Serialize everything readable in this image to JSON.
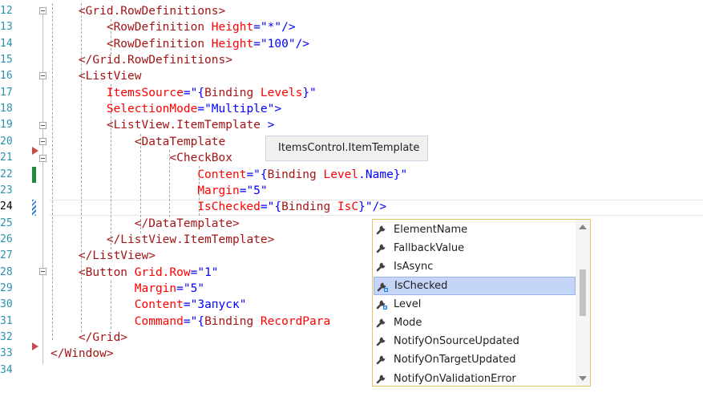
{
  "editor": {
    "current_line": "24",
    "lines": [
      {
        "n": "12",
        "c": [
          [
            "i",
            "    "
          ],
          [
            "t",
            "<Grid.RowDefinitions>"
          ]
        ]
      },
      {
        "n": "13",
        "c": [
          [
            "i",
            "        "
          ],
          [
            "t",
            "<RowDefinition "
          ],
          [
            "a",
            "Height"
          ],
          [
            "p",
            "=\"*\"/>"
          ]
        ]
      },
      {
        "n": "14",
        "c": [
          [
            "i",
            "        "
          ],
          [
            "t",
            "<RowDefinition "
          ],
          [
            "a",
            "Height"
          ],
          [
            "p",
            "=\"100\"/>"
          ]
        ]
      },
      {
        "n": "15",
        "c": [
          [
            "i",
            "    "
          ],
          [
            "t",
            "</Grid.RowDefinitions>"
          ]
        ]
      },
      {
        "n": "16",
        "c": [
          [
            "i",
            "    "
          ],
          [
            "t",
            "<ListView"
          ]
        ]
      },
      {
        "n": "17",
        "c": [
          [
            "i",
            "        "
          ],
          [
            "a",
            "ItemsSource"
          ],
          [
            "p",
            "=\"{"
          ],
          [
            "t",
            "Binding "
          ],
          [
            "a",
            "Levels"
          ],
          [
            "p",
            "}\""
          ]
        ]
      },
      {
        "n": "18",
        "c": [
          [
            "i",
            "        "
          ],
          [
            "a",
            "SelectionMode"
          ],
          [
            "p",
            "=\"Multiple\">"
          ]
        ]
      },
      {
        "n": "19",
        "c": [
          [
            "i",
            "        "
          ],
          [
            "t",
            "<ListView.ItemTemplate "
          ],
          [
            "p",
            ">"
          ]
        ]
      },
      {
        "n": "20",
        "c": [
          [
            "i",
            "            "
          ],
          [
            "t",
            "<DataTemplate"
          ]
        ]
      },
      {
        "n": "21",
        "c": [
          [
            "i",
            "                 "
          ],
          [
            "t",
            "<CheckBox"
          ]
        ]
      },
      {
        "n": "22",
        "c": [
          [
            "i",
            "                     "
          ],
          [
            "a",
            "Content"
          ],
          [
            "p",
            "=\"{"
          ],
          [
            "t",
            "Binding "
          ],
          [
            "a",
            "Level"
          ],
          [
            "p",
            "."
          ],
          [
            "b",
            "Name"
          ],
          [
            "p",
            "}\""
          ]
        ]
      },
      {
        "n": "23",
        "c": [
          [
            "i",
            "                     "
          ],
          [
            "a",
            "Margin"
          ],
          [
            "p",
            "=\"5\""
          ]
        ]
      },
      {
        "n": "24",
        "c": [
          [
            "i",
            "                     "
          ],
          [
            "a",
            "IsChecked"
          ],
          [
            "p",
            "=\"{"
          ],
          [
            "t",
            "Binding "
          ],
          [
            "a",
            "IsC"
          ],
          [
            "p",
            "}\"/>"
          ]
        ]
      },
      {
        "n": "25",
        "c": [
          [
            "i",
            "            "
          ],
          [
            "t",
            "</DataTemplate>"
          ]
        ]
      },
      {
        "n": "26",
        "c": [
          [
            "i",
            "        "
          ],
          [
            "t",
            "</ListView.ItemTemplate>"
          ]
        ]
      },
      {
        "n": "27",
        "c": [
          [
            "i",
            "    "
          ],
          [
            "t",
            "</ListView>"
          ]
        ]
      },
      {
        "n": "28",
        "c": [
          [
            "i",
            "    "
          ],
          [
            "t",
            "<Button "
          ],
          [
            "a",
            "Grid.Row"
          ],
          [
            "p",
            "=\"1\""
          ]
        ]
      },
      {
        "n": "29",
        "c": [
          [
            "i",
            "            "
          ],
          [
            "a",
            "Margin"
          ],
          [
            "p",
            "=\"5\""
          ]
        ]
      },
      {
        "n": "30",
        "c": [
          [
            "i",
            "            "
          ],
          [
            "a",
            "Content"
          ],
          [
            "p",
            "=\"Запуск\""
          ]
        ]
      },
      {
        "n": "31",
        "c": [
          [
            "i",
            "            "
          ],
          [
            "a",
            "Command"
          ],
          [
            "p",
            "=\"{"
          ],
          [
            "t",
            "Binding "
          ],
          [
            "a",
            "RecordPara"
          ]
        ]
      },
      {
        "n": "32",
        "c": [
          [
            "i",
            "    "
          ],
          [
            "t",
            "</Grid>"
          ]
        ]
      },
      {
        "n": "33",
        "c": [
          [
            "t",
            "</Window>"
          ]
        ]
      },
      {
        "n": "34",
        "c": []
      }
    ]
  },
  "tooltip": {
    "text": "ItemsControl.ItemTemplate"
  },
  "completion": {
    "items": [
      {
        "label": "ElementName",
        "icon": "wrench-icon",
        "selected": false
      },
      {
        "label": "FallbackValue",
        "icon": "wrench-icon",
        "selected": false
      },
      {
        "label": "IsAsync",
        "icon": "wrench-icon",
        "selected": false
      },
      {
        "label": "IsChecked",
        "icon": "wrench-blue-icon",
        "selected": true
      },
      {
        "label": "Level",
        "icon": "wrench-blue-icon",
        "selected": false
      },
      {
        "label": "Mode",
        "icon": "wrench-icon",
        "selected": false
      },
      {
        "label": "NotifyOnSourceUpdated",
        "icon": "wrench-icon",
        "selected": false
      },
      {
        "label": "NotifyOnTargetUpdated",
        "icon": "wrench-icon",
        "selected": false
      },
      {
        "label": "NotifyOnValidationError",
        "icon": "wrench-icon",
        "selected": false
      }
    ]
  },
  "colors": {
    "tag": "#a31515",
    "punct": "#0000ff",
    "attr": "#ff0000",
    "line_number": "#2b91af",
    "selection": "#c5d5f8",
    "popup_border": "#e5c365"
  }
}
